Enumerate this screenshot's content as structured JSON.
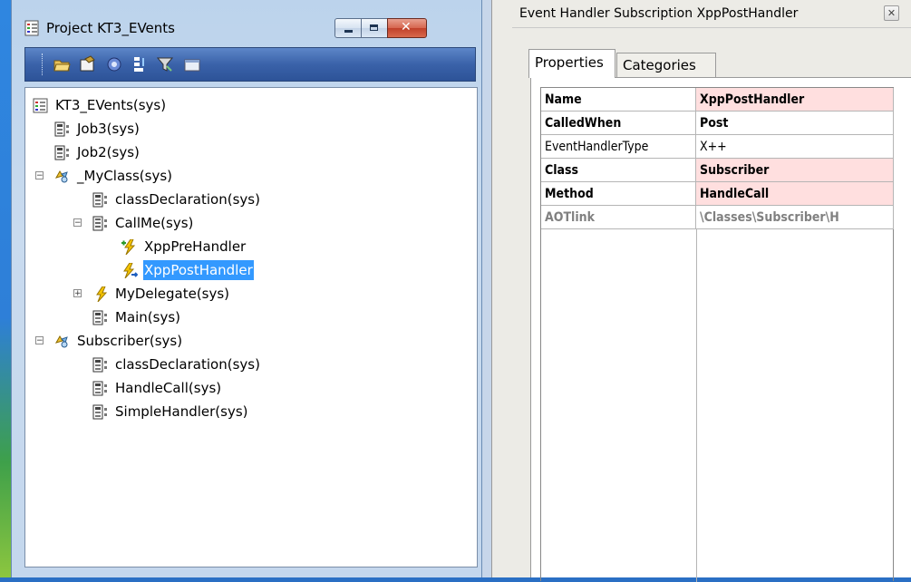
{
  "project_window": {
    "title": "Project KT3_EVents",
    "toolbar_icons": [
      "open-folder-icon",
      "properties-icon",
      "compile-icon",
      "import-icon",
      "filter-icon",
      "calendar-icon"
    ],
    "tree": [
      {
        "label": "KT3_EVents(sys)"
      },
      {
        "label": "Job3(sys)"
      },
      {
        "label": "Job2(sys)"
      },
      {
        "label": "_MyClass(sys)"
      },
      {
        "label": "classDeclaration(sys)"
      },
      {
        "label": "CallMe(sys)"
      },
      {
        "label": "XppPreHandler"
      },
      {
        "label": "XppPostHandler"
      },
      {
        "label": "MyDelegate(sys)"
      },
      {
        "label": "Main(sys)"
      },
      {
        "label": "Subscriber(sys)"
      },
      {
        "label": "classDeclaration(sys)"
      },
      {
        "label": "HandleCall(sys)"
      },
      {
        "label": "SimpleHandler(sys)"
      }
    ],
    "selected": "XppPostHandler"
  },
  "property_window": {
    "title": "Event Handler Subscription XppPostHandler",
    "close_label": "✕",
    "tabs": [
      "Properties",
      "Categories"
    ],
    "active_tab": "Properties",
    "rows": [
      {
        "name": "Name",
        "value": "XppPostHandler"
      },
      {
        "name": "CalledWhen",
        "value": "Post"
      },
      {
        "name": "EventHandlerType",
        "value": "X++"
      },
      {
        "name": "Class",
        "value": "Subscriber"
      },
      {
        "name": "Method",
        "value": "HandleCall"
      },
      {
        "name": "AOTlink",
        "value": "\\Classes\\Subscriber\\H"
      }
    ]
  },
  "colors": {
    "selection": "#3399ff",
    "highlight_pink": "#ffdfdf",
    "toolbar_blue": "#3a62a9"
  }
}
